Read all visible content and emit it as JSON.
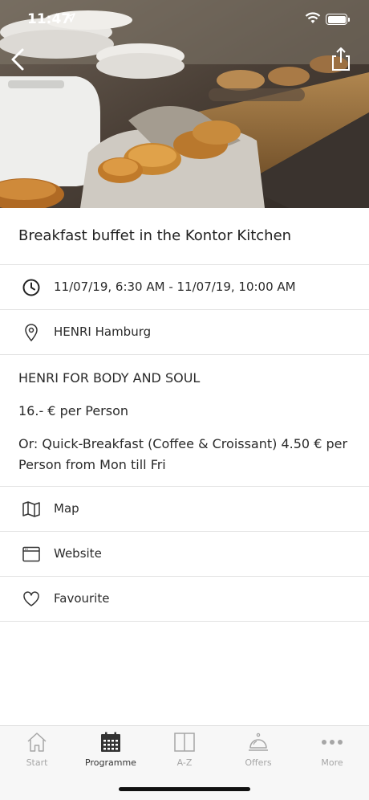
{
  "status_bar": {
    "time": "11:47"
  },
  "event": {
    "title": "Breakfast buffet in the Kontor Kitchen",
    "datetime": "11/07/19, 6:30 AM - 11/07/19, 10:00 AM",
    "location": "HENRI Hamburg",
    "description": [
      "HENRI FOR BODY AND SOUL",
      "16.- € per Person",
      "Or: Quick-Breakfast (Coffee & Croissant) 4.50 € per Person from Mon till Fri"
    ]
  },
  "actions": [
    {
      "label": "Map",
      "icon": "map-icon"
    },
    {
      "label": "Website",
      "icon": "browser-window-icon"
    },
    {
      "label": "Favourite",
      "icon": "heart-icon"
    }
  ],
  "tabbar": {
    "tabs": [
      {
        "label": "Start",
        "icon": "home-icon",
        "active": false
      },
      {
        "label": "Programme",
        "icon": "calendar-icon",
        "active": true
      },
      {
        "label": "A-Z",
        "icon": "book-icon",
        "active": false
      },
      {
        "label": "Offers",
        "icon": "service-bell-icon",
        "active": false
      },
      {
        "label": "More",
        "icon": "more-dots-icon",
        "active": false
      }
    ]
  },
  "colors": {
    "text": "#1e1e1e",
    "divider": "#e2e2e2",
    "tab_inactive": "#a6a6a6",
    "tab_active": "#333333"
  }
}
